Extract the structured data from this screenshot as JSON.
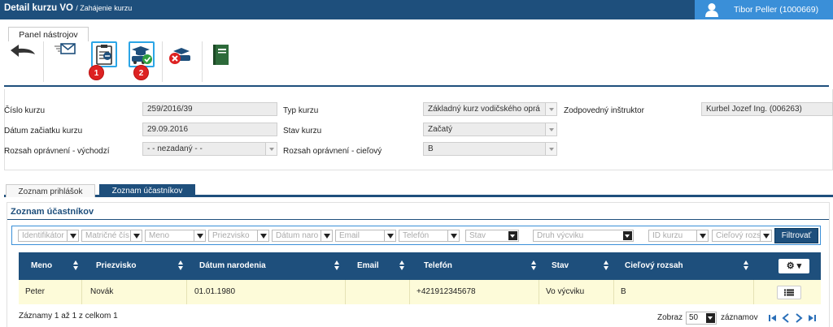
{
  "header": {
    "title": "Detail kurzu VO",
    "subtitle": "/ Zahájenie kurzu",
    "user_name": "Tibor Peller (1000669)"
  },
  "toolbar": {
    "tab_label": "Panel nástrojov",
    "badges": [
      "1",
      "2"
    ]
  },
  "form": {
    "course_number": {
      "label": "Číslo kurzu",
      "value": "259/2016/39"
    },
    "start_date": {
      "label": "Dátum začiatku kurzu",
      "value": "29.09.2016"
    },
    "scope_source": {
      "label": "Rozsah oprávnení - východzí",
      "value": "- - nezadaný - -"
    },
    "course_type": {
      "label": "Typ kurzu",
      "value": "Základný kurz vodičského oprá"
    },
    "course_state": {
      "label": "Stav kurzu",
      "value": "Začatý"
    },
    "scope_target": {
      "label": "Rozsah oprávnení - cieľový",
      "value": "B"
    },
    "instructor": {
      "label": "Zodpovedný inštruktor",
      "value": "Kurbel Jozef Ing. (006263)"
    }
  },
  "tabs": [
    "Zoznam prihlášok",
    "Zoznam účastníkov"
  ],
  "panel": {
    "title": "Zoznam účastníkov",
    "filters": {
      "identifier": "Identifikátor",
      "matric": "Matričné čís",
      "name": "Meno",
      "surname": "Priezvisko",
      "birthdate": "Dátum naro",
      "email": "Email",
      "phone": "Telefón",
      "state": "Stav",
      "training_type": "Druh výcviku",
      "course_id": "ID kurzu",
      "target_scope": "Cieľový rozs",
      "filter_button": "Filtrovať"
    },
    "columns": [
      "Meno",
      "Priezvisko",
      "Dátum narodenia",
      "Email",
      "Telefón",
      "Stav",
      "Cieľový rozsah"
    ],
    "rows": [
      [
        "Peter",
        "Novák",
        "01.01.1980",
        "",
        "+421912345678",
        "Vo výcviku",
        "B"
      ]
    ],
    "summary": "Záznamy 1 až 1 z celkom 1",
    "page_size_label_pre": "Zobraz",
    "page_size": "50",
    "page_size_label_post": "záznamov"
  },
  "colors": {
    "primary": "#1e4f7c",
    "accent": "#3a8fd8",
    "row_bg": "#fdfbd9",
    "highlight": "#2ba5e6",
    "badge": "#dd2222"
  },
  "icons": [
    "back-arrow-icon",
    "send-email-icon",
    "clipboard-document-icon",
    "graduation-car-check-icon",
    "cancel-course-icon",
    "book-icon",
    "filter-icon",
    "gear-icon",
    "list-icon",
    "user-icon"
  ]
}
